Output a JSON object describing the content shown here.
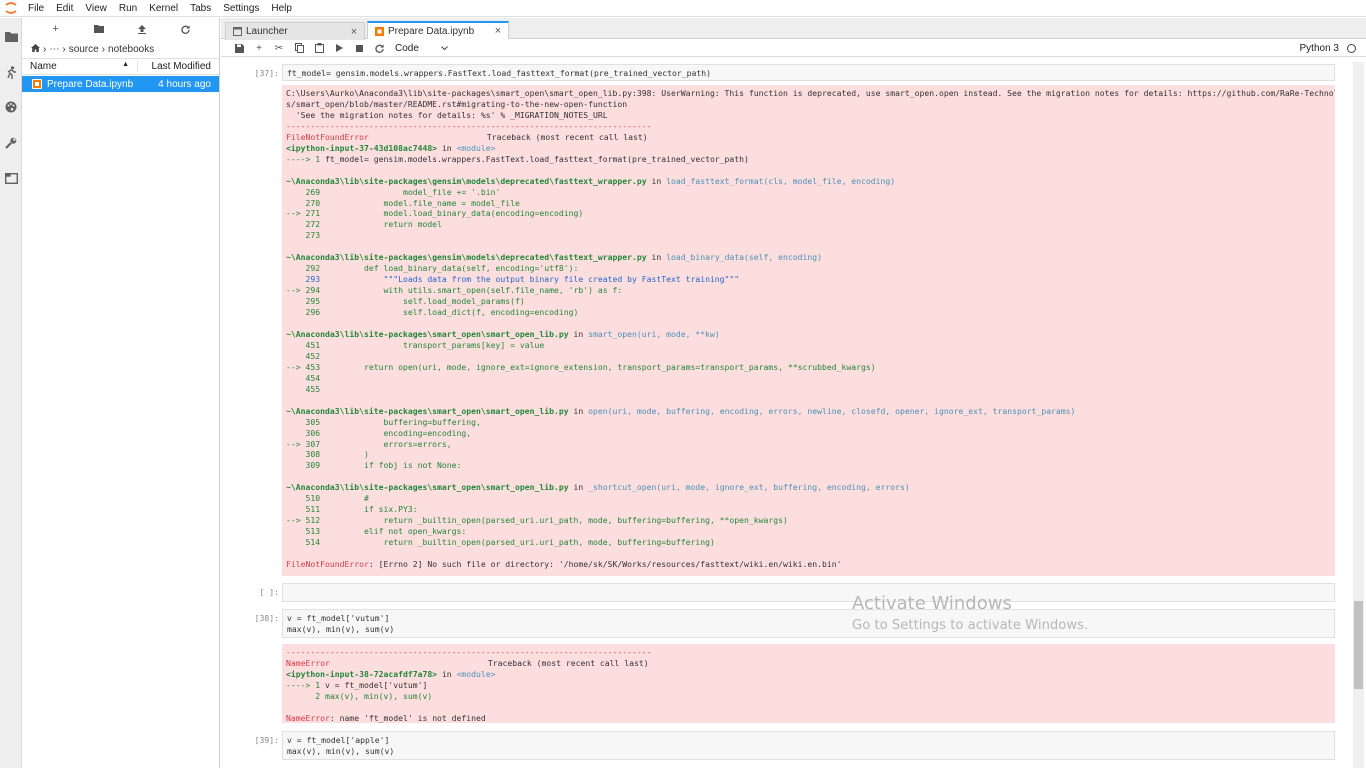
{
  "menu": [
    "File",
    "Edit",
    "View",
    "Run",
    "Kernel",
    "Tabs",
    "Settings",
    "Help"
  ],
  "icons": {
    "logo": "jupyter-logo-icon",
    "activity": [
      "folder-icon",
      "running-icon",
      "palette-icon",
      "wrench-icon",
      "tabs-icon"
    ],
    "filebrowser_tools": [
      "new-launcher-icon",
      "new-folder-icon",
      "upload-icon",
      "refresh-icon"
    ]
  },
  "filebrowser": {
    "breadcrumbs": [
      "⋯",
      "source",
      "notebooks"
    ],
    "col_name": "Name",
    "col_modified": "Last Modified",
    "sort_arrow": "▲",
    "files": [
      {
        "name": "Prepare Data.ipynb",
        "modified": "4 hours ago"
      }
    ]
  },
  "tabs": [
    {
      "label": "Launcher",
      "close": "×"
    },
    {
      "label": "Prepare Data.ipynb",
      "close": "×"
    }
  ],
  "toolbar": {
    "cell_type": "Code",
    "kernel": "Python 3"
  },
  "cells": {
    "c37": {
      "prompt": "[37]:",
      "code": "ft_model= gensim.models.wrappers.FastText.load_fasttext_format(pre_trained_vector_path)"
    },
    "c37_out": {
      "warn1": "C:\\Users\\Aurko\\Anaconda3\\lib\\site-packages\\smart_open\\smart_open_lib.py:398: UserWarning: This function is deprecated, use smart_open.open instead. See the migration notes for details: https://github.com/RaRe-Technologie",
      "warn2": "s/smart_open/blob/master/README.rst#migrating-to-the-new-open-function",
      "warn3": "  'See the migration notes for details: %s' % _MIGRATION_NOTES_URL",
      "sep": "---------------------------------------------------------------------------",
      "err_name": "FileNotFoundError",
      "traceback_hdr": "Traceback (most recent call last)",
      "input_ref": "<ipython-input-37-43d108ac7448>",
      "in": "in",
      "module": "<module>",
      "arrow1": "----> 1 ",
      "arrow1_code": "ft_model= gensim.models.wrappers.FastText.load_fasttext_format(pre_trained_vector_path)",
      "f1_path": "~\\Anaconda3\\lib\\site-packages\\gensim\\models\\deprecated\\fasttext_wrapper.py",
      "f1_func": "load_fasttext_format(cls, model_file, encoding)",
      "f1_l269": "    269                 model_file += '.bin'",
      "f1_l270": "    270             model.file_name = model_file",
      "f1_l271": "--> 271             model.load_binary_data(encoding=encoding)",
      "f1_l272": "    272             return model",
      "f1_l273": "    273",
      "f2_path": "~\\Anaconda3\\lib\\site-packages\\gensim\\models\\deprecated\\fasttext_wrapper.py",
      "f2_func": "load_binary_data(self, encoding)",
      "f2_l292": "    292         def load_binary_data(self, encoding='utf8'):",
      "f2_l293": "    293             \"\"\"Loads data from the output binary file created by FastText training\"\"\"",
      "f2_l294": "--> 294             with utils.smart_open(self.file_name, 'rb') as f:",
      "f2_l295": "    295                 self.load_model_params(f)",
      "f2_l296": "    296                 self.load_dict(f, encoding=encoding)",
      "f3_path": "~\\Anaconda3\\lib\\site-packages\\smart_open\\smart_open_lib.py",
      "f3_func": "smart_open(uri, mode, **kw)",
      "f3_l451": "    451                 transport_params[key] = value",
      "f3_l452": "    452",
      "f3_l453": "--> 453         return open(uri, mode, ignore_ext=ignore_extension, transport_params=transport_params, **scrubbed_kwargs)",
      "f3_l454": "    454",
      "f3_l455": "    455",
      "f4_path": "~\\Anaconda3\\lib\\site-packages\\smart_open\\smart_open_lib.py",
      "f4_func": "open(uri, mode, buffering, encoding, errors, newline, closefd, opener, ignore_ext, transport_params)",
      "f4_l305": "    305             buffering=buffering,",
      "f4_l306": "    306             encoding=encoding,",
      "f4_l307": "--> 307             errors=errors,",
      "f4_l308": "    308         )",
      "f4_l309": "    309         if fobj is not None:",
      "f5_path": "~\\Anaconda3\\lib\\site-packages\\smart_open\\smart_open_lib.py",
      "f5_func": "_shortcut_open(uri, mode, ignore_ext, buffering, encoding, errors)",
      "f5_l510": "    510         #",
      "f5_l511": "    511         if six.PY3:",
      "f5_l512": "--> 512             return _builtin_open(parsed_uri.uri_path, mode, buffering=buffering, **open_kwargs)",
      "f5_l513": "    513         elif not open_kwargs:",
      "f5_l514": "    514             return _builtin_open(parsed_uri.uri_path, mode, buffering=buffering)",
      "final_name": "FileNotFoundError",
      "final_msg": ": [Errno 2] No such file or directory: '/home/sk/SK/Works/resources/fasttext/wiki.en/wiki.en.bin'"
    },
    "empty": {
      "prompt": "[ ]:"
    },
    "c38": {
      "prompt": "[38]:",
      "code1": "v = ft_model['vutum']",
      "code2": "max(v), min(v), sum(v)"
    },
    "c38_out": {
      "sep": "---------------------------------------------------------------------------",
      "err_name": "NameError",
      "traceback_hdr": "Traceback (most recent call last)",
      "input_ref": "<ipython-input-38-72acafdf7a78>",
      "in": "in",
      "module": "<module>",
      "arrow1": "----> 1 ",
      "arrow1_code": "v = ft_model['vutum']",
      "l2": "      2 max(v), min(v), sum(v)",
      "final_name": "NameError",
      "final_msg": ": name 'ft_model' is not defined"
    },
    "c39": {
      "prompt": "[39]:",
      "code1": "v = ft_model['apple']",
      "code2": "max(v), min(v), sum(v)"
    }
  },
  "watermark": {
    "title": "Activate Windows",
    "subtitle": "Go to Settings to activate Windows."
  }
}
